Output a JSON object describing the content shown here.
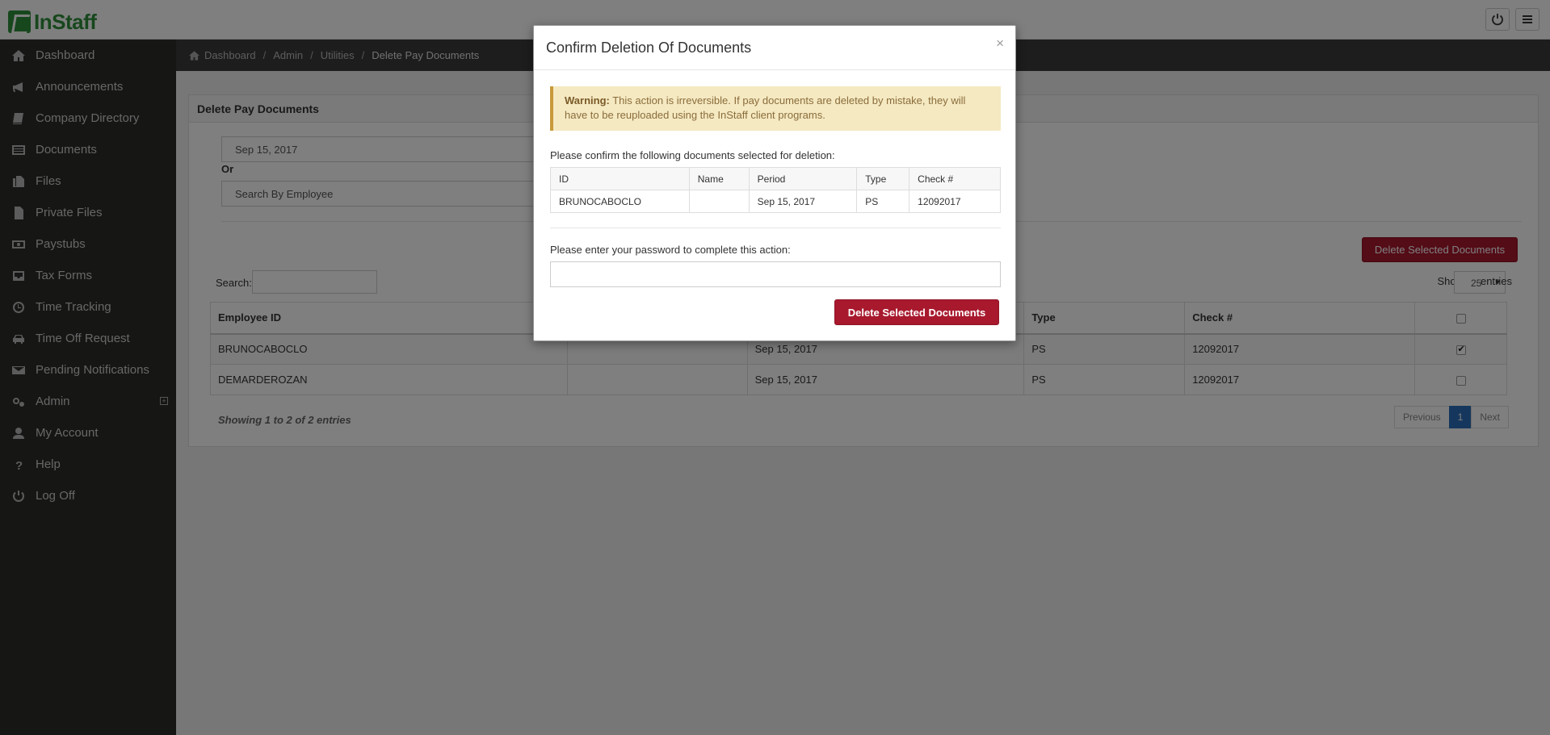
{
  "app": {
    "name": "InStaff"
  },
  "sidebar": {
    "items": [
      {
        "label": "Dashboard",
        "icon": "home-icon"
      },
      {
        "label": "Announcements",
        "icon": "bullhorn-icon"
      },
      {
        "label": "Company Directory",
        "icon": "book-icon"
      },
      {
        "label": "Documents",
        "icon": "list-icon"
      },
      {
        "label": "Files",
        "icon": "files-icon"
      },
      {
        "label": "Private Files",
        "icon": "file-icon"
      },
      {
        "label": "Paystubs",
        "icon": "money-icon"
      },
      {
        "label": "Tax Forms",
        "icon": "inbox-icon"
      },
      {
        "label": "Time Tracking",
        "icon": "clock-icon"
      },
      {
        "label": "Time Off Request",
        "icon": "car-icon"
      },
      {
        "label": "Pending Notifications",
        "icon": "envelope-icon"
      },
      {
        "label": "Admin",
        "icon": "cogs-icon"
      },
      {
        "label": "My Account",
        "icon": "user-icon"
      },
      {
        "label": "Help",
        "icon": "question-icon"
      },
      {
        "label": "Log Off",
        "icon": "power-icon"
      }
    ]
  },
  "breadcrumb": [
    "Dashboard",
    "Admin",
    "Utilities",
    "Delete Pay Documents"
  ],
  "panel": {
    "title": "Delete Pay Documents",
    "date_value": "Sep 15, 2017",
    "or_label": "Or",
    "employee_placeholder": "Search By Employee",
    "delete_button": "Delete Selected Documents",
    "search_label": "Search:",
    "show_label": "Show",
    "page_size": "25",
    "entries_label": "entries",
    "columns": [
      "Employee ID",
      "",
      "",
      "Type",
      "Check #",
      ""
    ],
    "rows": [
      {
        "employee_id": "BRUNOCABOCLO",
        "name": "",
        "period": "Sep 15, 2017",
        "type": "PS",
        "check": "12092017",
        "selected": true
      },
      {
        "employee_id": "DEMARDEROZAN",
        "name": "",
        "period": "Sep 15, 2017",
        "type": "PS",
        "check": "12092017",
        "selected": false
      }
    ],
    "showing": "Showing 1 to 2 of 2 entries",
    "pager": {
      "previous": "Previous",
      "current": "1",
      "next": "Next"
    }
  },
  "modal": {
    "title": "Confirm Deletion Of Documents",
    "close": "×",
    "warning_label": "Warning:",
    "warning_text": "This action is irreversible. If pay documents are deleted by mistake, they will have to be reuploaded using the InStaff client programs.",
    "confirm_text": "Please confirm the following documents selected for deletion:",
    "columns": [
      "ID",
      "Name",
      "Period",
      "Type",
      "Check #"
    ],
    "rows": [
      {
        "id": "BRUNOCABOCLO",
        "name": "",
        "period": "Sep 15, 2017",
        "type": "PS",
        "check": "12092017"
      }
    ],
    "password_prompt": "Please enter your password to complete this action:",
    "submit_button": "Delete Selected Documents"
  },
  "colors": {
    "brand": "#2f8f3a",
    "danger": "#a8192e",
    "sidebar": "#2d2d2b",
    "active_page": "#2a6ebb"
  }
}
